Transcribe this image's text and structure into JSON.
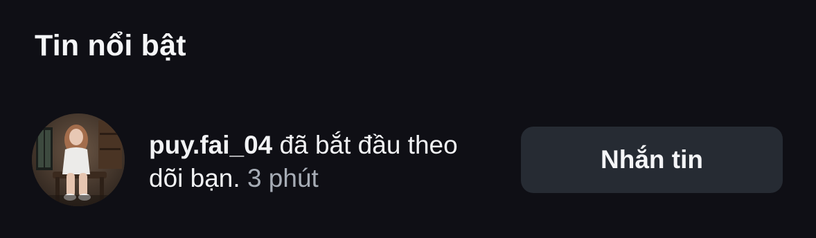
{
  "header": {
    "title": "Tin nổi bật"
  },
  "notification": {
    "username": "puy.fai_04",
    "message": " đã bắt đầu theo dõi bạn. ",
    "time": "3 phút",
    "avatar_icon": "profile-photo",
    "action_label": "Nhắn tin"
  },
  "colors": {
    "background": "#0f0f15",
    "text_primary": "#f4f5f7",
    "text_secondary": "#a7adb6",
    "button_background": "#262b33"
  }
}
